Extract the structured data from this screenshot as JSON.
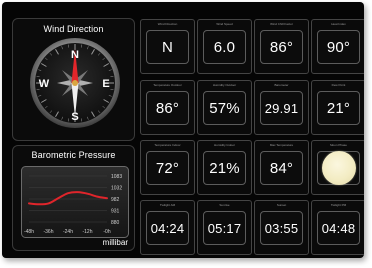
{
  "wind_panel": {
    "title": "Wind Direction",
    "compass": {
      "north": "N",
      "south": "S",
      "east": "E",
      "west": "W",
      "direction_degrees": 0
    }
  },
  "baro_panel": {
    "title": "Barometric Pressure",
    "unit": "millibar",
    "y_ticks": [
      "1083",
      "1032",
      "982",
      "931",
      "880"
    ],
    "x_ticks": [
      "-48h",
      "-36h",
      "-24h",
      "-12h",
      "-0h"
    ],
    "line_color": "#e0252b",
    "chart_data": {
      "type": "line",
      "x": [
        -48,
        -42,
        -36,
        -30,
        -24,
        -18,
        -12,
        -6,
        0
      ],
      "values": [
        962,
        958,
        962,
        985,
        1007,
        1012,
        1005,
        992,
        985
      ],
      "ylim": [
        880,
        1083
      ]
    }
  },
  "tiles": [
    {
      "id": "wind-direction",
      "label": "Wind Direction",
      "value": "N"
    },
    {
      "id": "wind-speed",
      "label": "Wind Speed",
      "value": "6.0"
    },
    {
      "id": "wind-chill",
      "label": "Wind Chill Factor",
      "value": "86°"
    },
    {
      "id": "heat-index",
      "label": "Heat Index",
      "value": "90°"
    },
    {
      "id": "temp-outdoor",
      "label": "Temperature Outdoor",
      "value": "86°"
    },
    {
      "id": "humidity-outdoor",
      "label": "Humidity Outdoor",
      "value": "57%"
    },
    {
      "id": "barometer",
      "label": "Barometer",
      "value": "29.91"
    },
    {
      "id": "dew-point",
      "label": "Dew Point",
      "value": "21°"
    },
    {
      "id": "temp-indoor",
      "label": "Temperature Indoor",
      "value": "72°"
    },
    {
      "id": "humidity-indoor",
      "label": "Humidity Indoor",
      "value": "21%"
    },
    {
      "id": "max-temp",
      "label": "Max Temperature",
      "value": "84°"
    },
    {
      "id": "moon-phase",
      "label": "Moon Phase",
      "value": ""
    },
    {
      "id": "twilight",
      "label": "Twilight AM",
      "value": "04:24"
    },
    {
      "id": "sunrise",
      "label": "Sunrise",
      "value": "05:17"
    },
    {
      "id": "sunset",
      "label": "Sunset",
      "value": "03:55"
    },
    {
      "id": "twilight-pm",
      "label": "Twilight PM",
      "value": "04:48"
    }
  ]
}
